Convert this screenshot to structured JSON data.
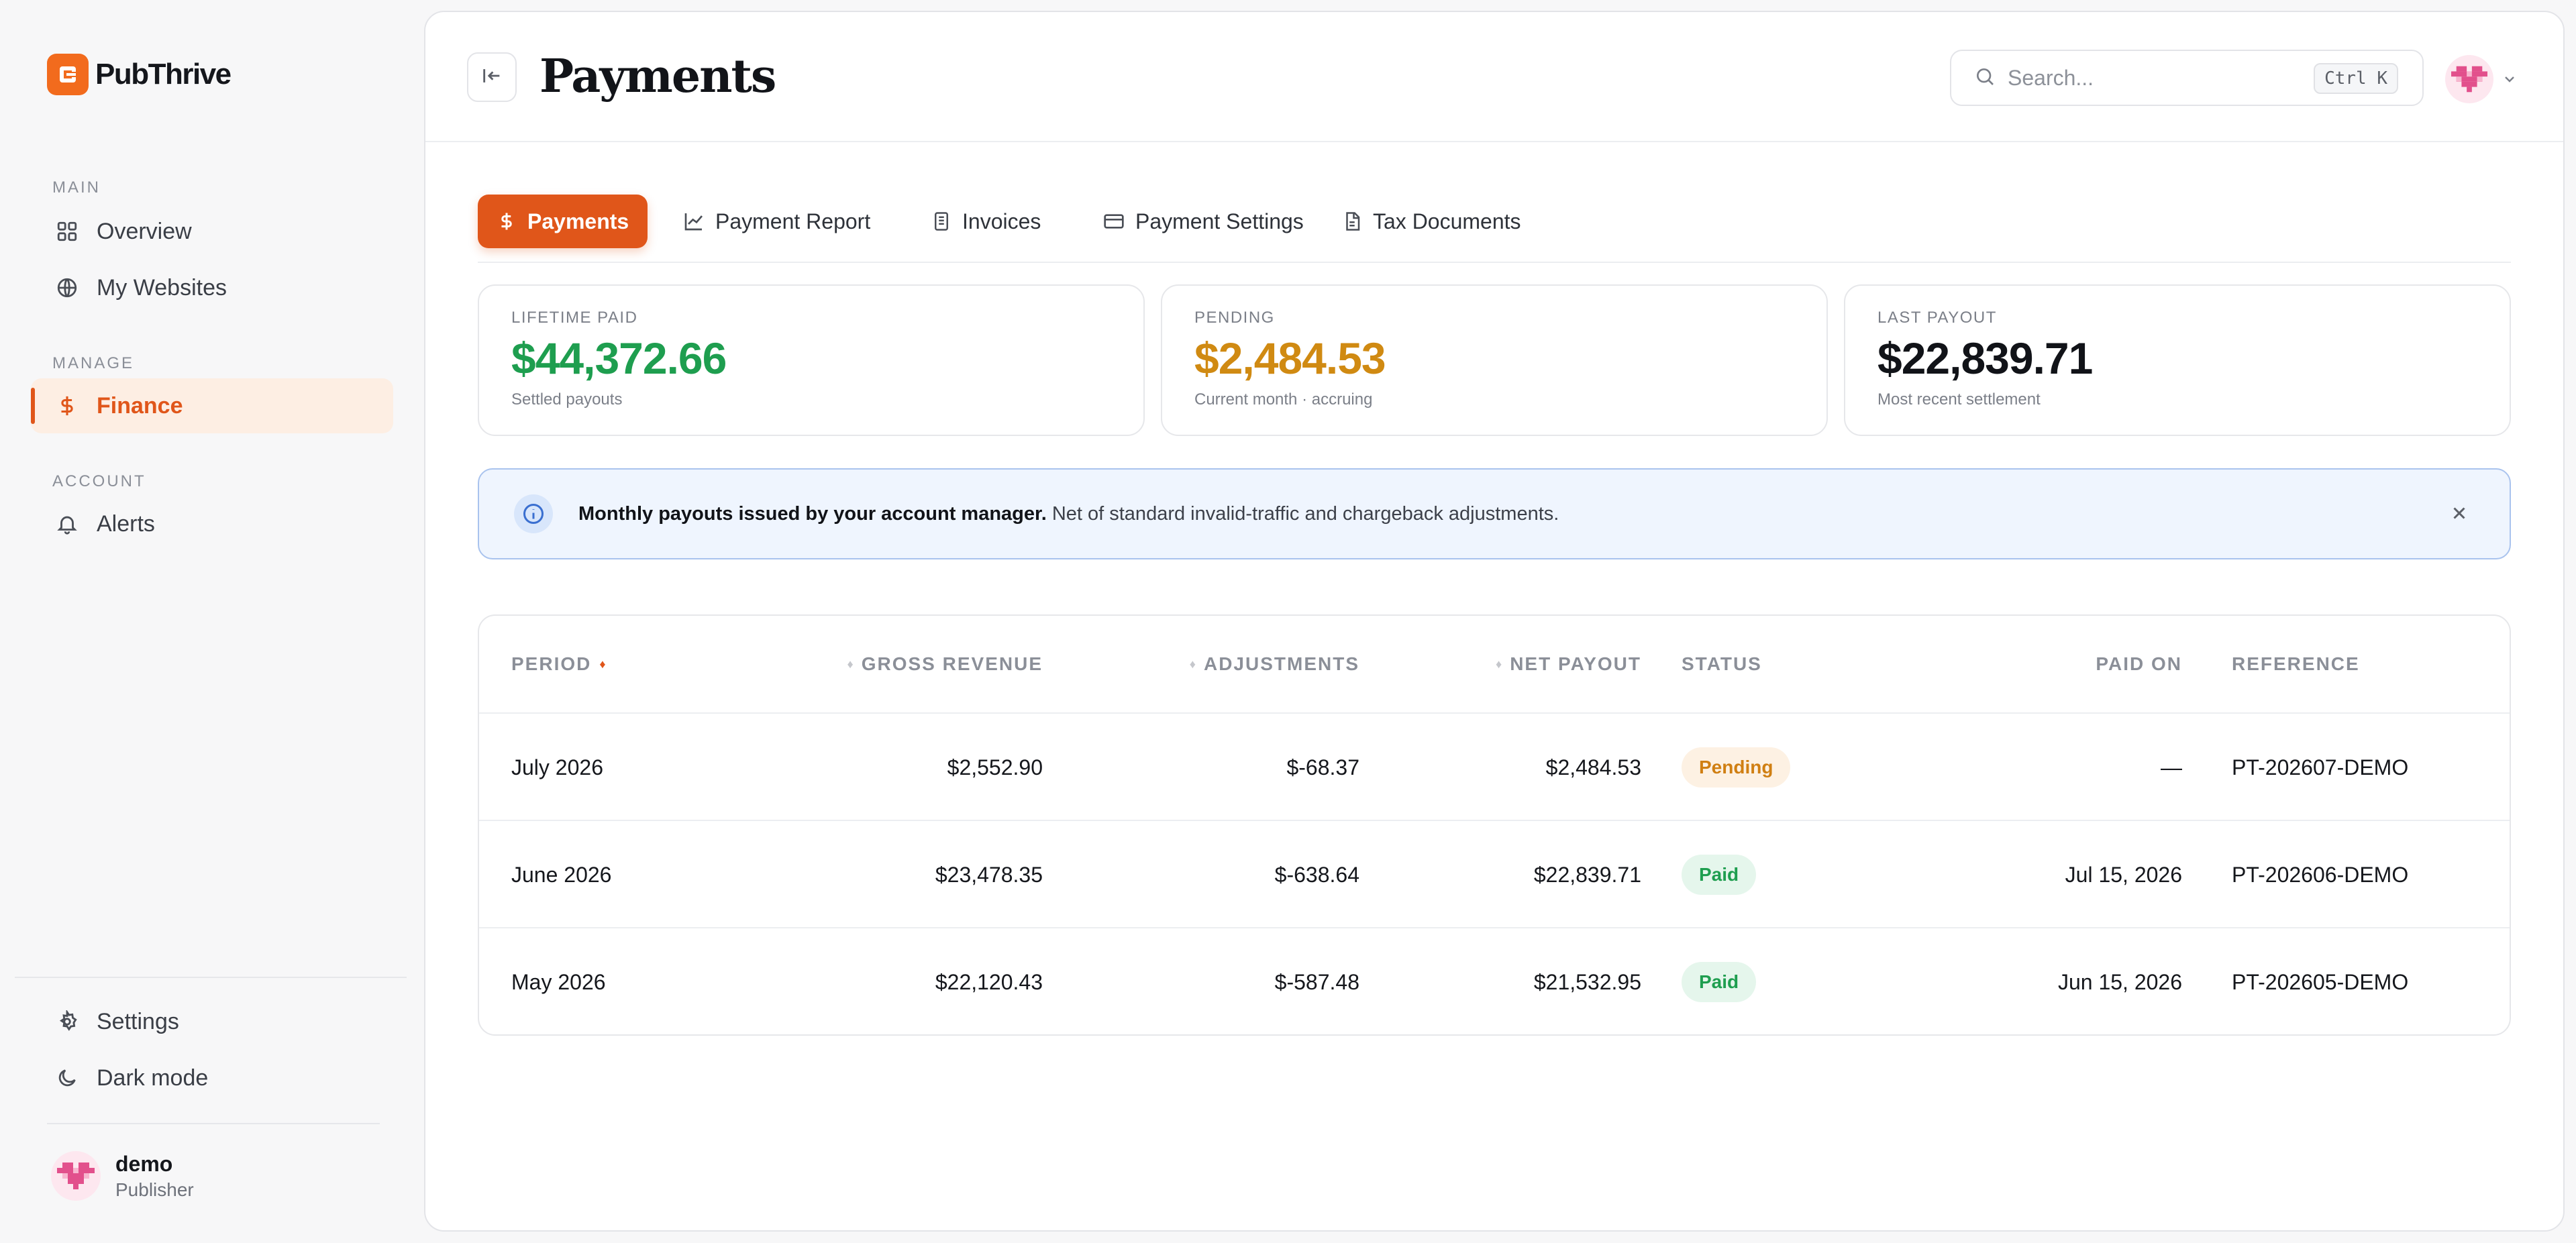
{
  "brand": {
    "name": "PubThrive",
    "accent": "#f26b1d"
  },
  "sidebar": {
    "sections": {
      "main": "MAIN",
      "manage": "MANAGE",
      "account": "ACCOUNT"
    },
    "items": [
      {
        "label": "Overview",
        "icon": "grid-icon"
      },
      {
        "label": "My Websites",
        "icon": "globe-icon"
      },
      {
        "label": "Finance",
        "icon": "dollar-icon",
        "active": true
      },
      {
        "label": "Alerts",
        "icon": "bell-icon"
      }
    ],
    "bottom": [
      {
        "label": "Settings",
        "icon": "gear-icon"
      },
      {
        "label": "Dark mode",
        "icon": "moon-icon"
      }
    ],
    "user": {
      "name": "demo",
      "role": "Publisher"
    }
  },
  "header": {
    "title": "Payments",
    "search_placeholder": "Search...",
    "shortcut": "Ctrl K"
  },
  "tabs": [
    {
      "label": "Payments",
      "icon": "dollar-icon",
      "active": true
    },
    {
      "label": "Payment Report",
      "icon": "chart-icon"
    },
    {
      "label": "Invoices",
      "icon": "document-icon"
    },
    {
      "label": "Payment Settings",
      "icon": "card-icon"
    },
    {
      "label": "Tax Documents",
      "icon": "file-icon"
    }
  ],
  "stats": [
    {
      "label": "LIFETIME PAID",
      "value": "$44,372.66",
      "sub": "Settled payouts",
      "color": "#1e9e4f"
    },
    {
      "label": "PENDING",
      "value": "$2,484.53",
      "sub": "Current month · accruing",
      "color": "#d08a12"
    },
    {
      "label": "LAST PAYOUT",
      "value": "$22,839.71",
      "sub": "Most recent settlement",
      "color": "#111318"
    }
  ],
  "banner": {
    "bold": "Monthly payouts issued by your account manager.",
    "text": " Net of standard invalid-traffic and chargeback adjustments."
  },
  "table": {
    "columns": [
      "PERIOD",
      "GROSS REVENUE",
      "ADJUSTMENTS",
      "NET PAYOUT",
      "STATUS",
      "PAID ON",
      "REFERENCE"
    ],
    "rows": [
      {
        "period": "July 2026",
        "gross": "$2,552.90",
        "adj": "$-68.37",
        "net": "$2,484.53",
        "status": "Pending",
        "paid_on": "—",
        "ref": "PT-202607-DEMO"
      },
      {
        "period": "June 2026",
        "gross": "$23,478.35",
        "adj": "$-638.64",
        "net": "$22,839.71",
        "status": "Paid",
        "paid_on": "Jul 15, 2026",
        "ref": "PT-202606-DEMO"
      },
      {
        "period": "May 2026",
        "gross": "$22,120.43",
        "adj": "$-587.48",
        "net": "$21,532.95",
        "status": "Paid",
        "paid_on": "Jun 15, 2026",
        "ref": "PT-202605-DEMO"
      }
    ]
  }
}
